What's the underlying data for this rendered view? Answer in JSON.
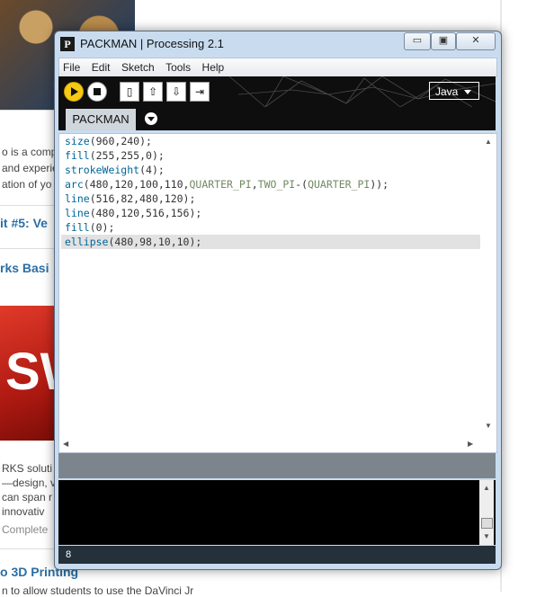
{
  "background_page": {
    "lines": [
      "o is a comp",
      "and experie",
      "ation of yo"
    ],
    "heading_1": "it #5: Ve",
    "heading_2": "rks Basi",
    "logo_letters": "SW",
    "para_lines": [
      "RKS soluti",
      "—design, v",
      "can span r",
      "innovativ"
    ],
    "complete": "Complete",
    "heading_3": "o 3D Printing",
    "bottom_line": "n to allow students to use the DaVinci Jr"
  },
  "window": {
    "icon_letter": "P",
    "title": "PACKMAN | Processing 2.1",
    "controls": {
      "minimize": "▭",
      "maximize": "▣",
      "close": "✕"
    }
  },
  "menu": [
    "File",
    "Edit",
    "Sketch",
    "Tools",
    "Help"
  ],
  "toolbar": {
    "run_icon": "play-icon",
    "stop_icon": "stop-icon",
    "new_icon": "new-icon",
    "open_icon": "open-icon",
    "save_icon": "save-icon",
    "export_icon": "export-icon",
    "mode": "Java"
  },
  "tabs": {
    "active": "PACKMAN"
  },
  "editor": {
    "lines": [
      [
        {
          "t": "size",
          "c": "fn"
        },
        {
          "t": "(960,240);",
          "c": ""
        }
      ],
      [
        {
          "t": "fill",
          "c": "fn"
        },
        {
          "t": "(255,255,0);",
          "c": ""
        }
      ],
      [
        {
          "t": "strokeWeight",
          "c": "fn"
        },
        {
          "t": "(4);",
          "c": ""
        }
      ],
      [
        {
          "t": "arc",
          "c": "fn"
        },
        {
          "t": "(480,120,100,110,",
          "c": ""
        },
        {
          "t": "QUARTER_PI",
          "c": "kw"
        },
        {
          "t": ",",
          "c": ""
        },
        {
          "t": "TWO_PI",
          "c": "kw"
        },
        {
          "t": "-(",
          "c": ""
        },
        {
          "t": "QUARTER_PI",
          "c": "kw"
        },
        {
          "t": "));",
          "c": ""
        }
      ],
      [
        {
          "t": "line",
          "c": "fn"
        },
        {
          "t": "(516,82,480,120);",
          "c": ""
        }
      ],
      [
        {
          "t": "line",
          "c": "fn"
        },
        {
          "t": "(480,120,516,156);",
          "c": ""
        }
      ],
      [
        {
          "t": "fill",
          "c": "fn"
        },
        {
          "t": "(0);",
          "c": ""
        }
      ],
      [
        {
          "t": "ellipse",
          "c": "fn"
        },
        {
          "t": "(480,98,10,10);",
          "c": ""
        }
      ]
    ],
    "current_line": 8
  },
  "status": {
    "line_number": "8"
  },
  "colors": {
    "run_button": "#f6c915",
    "toolbar_bg": "#0e0e0e",
    "function_text": "#006699",
    "constant_text": "#718a62"
  }
}
